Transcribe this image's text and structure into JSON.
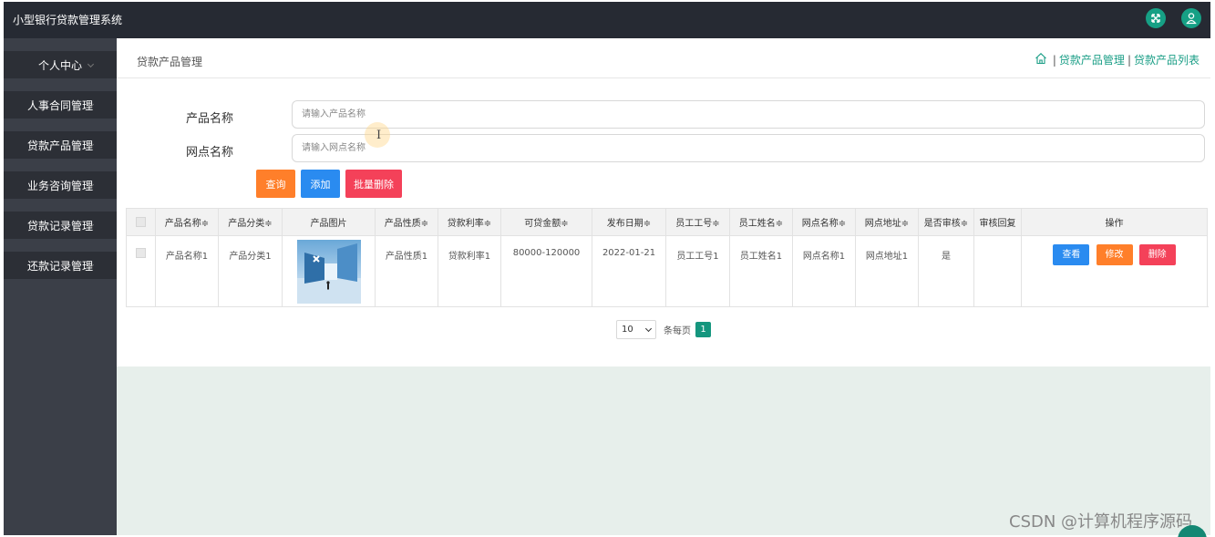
{
  "app": {
    "title": "小型银行贷款管理系统"
  },
  "header": {
    "icons": [
      "fullscreen-icon",
      "user-icon"
    ]
  },
  "sidebar": {
    "items": [
      {
        "label": "个人中心"
      },
      {
        "label": "人事合同管理"
      },
      {
        "label": "贷款产品管理"
      },
      {
        "label": "业务咨询管理"
      },
      {
        "label": "贷款记录管理"
      },
      {
        "label": "还款记录管理"
      }
    ]
  },
  "page": {
    "title": "贷款产品管理",
    "breadcrumb": {
      "separator": "|",
      "items": [
        "贷款产品管理",
        "贷款产品列表"
      ]
    }
  },
  "search": {
    "product_name": {
      "label": "产品名称",
      "placeholder": "请输入产品名称",
      "value": ""
    },
    "branch_name": {
      "label": "网点名称",
      "placeholder": "请输入网点名称",
      "value": ""
    },
    "query_label": "查询",
    "add_label": "添加",
    "bulk_delete_label": "批量删除"
  },
  "table": {
    "columns": [
      "产品名称≑",
      "产品分类≑",
      "产品图片",
      "产品性质≑",
      "贷款利率≑",
      "可贷金额≑",
      "发布日期≑",
      "员工工号≑",
      "员工姓名≑",
      "网点名称≑",
      "网点地址≑",
      "是否审核≑",
      "审核回复",
      "操作"
    ],
    "rows": [
      {
        "product_name": "产品名称1",
        "category": "产品分类1",
        "nature": "产品性质1",
        "rate": "贷款利率1",
        "amount": "80000-120000",
        "date": "2022-01-21",
        "employee_no": "员工工号1",
        "employee_name": "员工姓名1",
        "branch_name": "网点名称1",
        "branch_address": "网点地址1",
        "reviewed": "是",
        "review_reply": ""
      }
    ],
    "actions": {
      "view": "查看",
      "edit": "修改",
      "delete": "删除"
    }
  },
  "pagination": {
    "page_size": "10",
    "per_page_label": "条每页",
    "current_page": "1"
  },
  "watermark": "CSDN @计算机程序源码",
  "colors": {
    "sidebar": "#3b3f48",
    "header": "#262a33",
    "accent": "#16a085",
    "orange": "#ff7f2a",
    "blue": "#2a8bf0",
    "red": "#f44159"
  }
}
